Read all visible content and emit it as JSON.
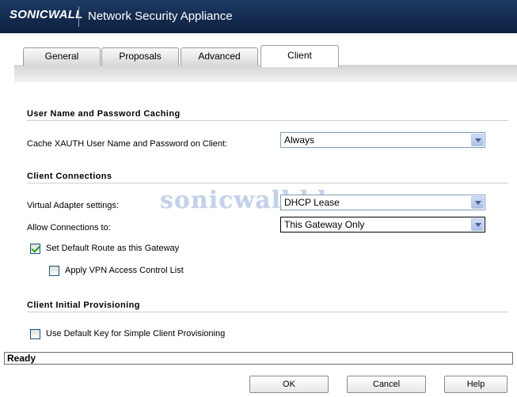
{
  "header": {
    "logo_text": "SONICWALL",
    "app_title": "Network Security Appliance"
  },
  "tabs": [
    {
      "label": "General"
    },
    {
      "label": "Proposals"
    },
    {
      "label": "Advanced"
    },
    {
      "label": "Client",
      "active": true
    }
  ],
  "sections": {
    "caching": {
      "title": "User Name and Password Caching",
      "cache_label": "Cache XAUTH User Name and Password on Client:",
      "cache_value": "Always"
    },
    "connections": {
      "title": "Client Connections",
      "adapter_label": "Virtual Adapter settings:",
      "adapter_value": "DHCP Lease",
      "allow_label": "Allow Connections to:",
      "allow_value": "This Gateway Only",
      "default_route_label": "Set Default Route as this Gateway",
      "default_route_checked": true,
      "acl_label": "Apply VPN Access Control List",
      "acl_checked": false
    },
    "provisioning": {
      "title": "Client Initial Provisioning",
      "default_key_label": "Use Default Key for Simple Client Provisioning",
      "default_key_checked": false
    }
  },
  "watermark": "sonicwall.bk",
  "status": "Ready",
  "buttons": {
    "ok": "OK",
    "cancel": "Cancel",
    "help": "Help"
  },
  "colors": {
    "header_bg": "#13294c",
    "check_mark": "#21a121",
    "select_border": "#7f9db9"
  }
}
